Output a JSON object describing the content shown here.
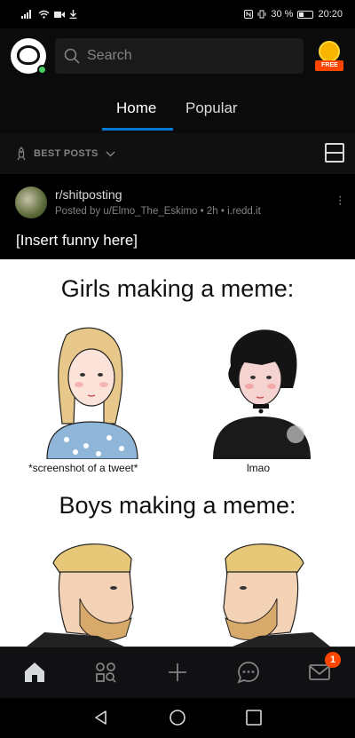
{
  "status_bar": {
    "battery": "30 %",
    "time": "20:20"
  },
  "header": {
    "search_placeholder": "Search",
    "premium_badge": "FREE"
  },
  "tabs": [
    {
      "label": "Home",
      "active": true
    },
    {
      "label": "Popular",
      "active": false
    }
  ],
  "sort": {
    "label": "BEST POSTS"
  },
  "post": {
    "subreddit": "r/shitposting",
    "meta": "Posted by u/Elmo_The_Eskimo • 2h • i.redd.it",
    "title": "[Insert funny here]",
    "meme": {
      "heading_top": "Girls making a meme:",
      "caption_left": "*screenshot of a tweet*",
      "caption_right": "lmao",
      "heading_bottom": "Boys making a meme:"
    }
  },
  "bottom_nav": {
    "items": [
      "home",
      "communities",
      "create",
      "chat",
      "inbox"
    ],
    "inbox_badge": "1"
  },
  "colors": {
    "accent": "#0079d3",
    "badge": "#ff4500",
    "online": "#46d160"
  }
}
